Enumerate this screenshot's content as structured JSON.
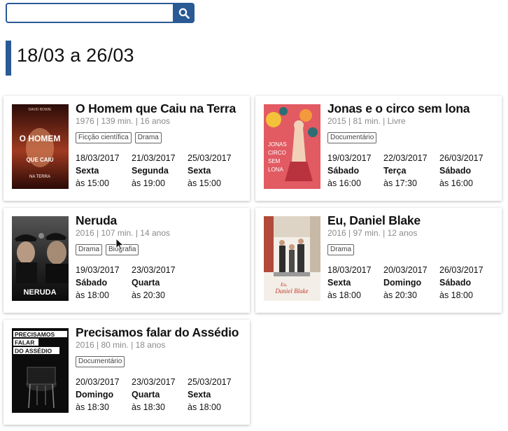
{
  "search": {
    "placeholder": "",
    "value": ""
  },
  "title": "18/03 a 26/03",
  "movies": [
    {
      "title": "O Homem que Caiu na Terra",
      "meta": "1976 | 139 min. | 16 anos",
      "tags": [
        "Ficção científica",
        "Drama"
      ],
      "poster_text": [
        "DAVID BOWIE",
        "O HOMEM",
        "QUE CAIU",
        "NA TERRA"
      ],
      "sessions": [
        {
          "date": "18/03/2017",
          "day": "Sexta",
          "time": "às 15:00"
        },
        {
          "date": "21/03/2017",
          "day": "Segunda",
          "time": "às 19:00"
        },
        {
          "date": "25/03/2017",
          "day": "Sexta",
          "time": "às 15:00"
        }
      ]
    },
    {
      "title": "Jonas e o circo sem lona",
      "meta": "2015 | 81 min. | Livre",
      "tags": [
        "Documentário"
      ],
      "poster_text": [
        "JONAS",
        "CIRCO",
        "SEM",
        "LONA"
      ],
      "sessions": [
        {
          "date": "19/03/2017",
          "day": "Sábado",
          "time": "às 16:00"
        },
        {
          "date": "22/03/2017",
          "day": "Terça",
          "time": "às 17:30"
        },
        {
          "date": "26/03/2017",
          "day": "Sábado",
          "time": "às 16:00"
        }
      ]
    },
    {
      "title": "Neruda",
      "meta": "2016 | 107 min. | 14 anos",
      "tags": [
        "Drama",
        "Biografia"
      ],
      "poster_text": [
        "NERUDA"
      ],
      "sessions": [
        {
          "date": "19/03/2017",
          "day": "Sábado",
          "time": "às 18:00"
        },
        {
          "date": "23/03/2017",
          "day": "Quarta",
          "time": "às 20:30"
        }
      ]
    },
    {
      "title": "Eu, Daniel Blake",
      "meta": "2016 | 97 min. | 12 anos",
      "tags": [
        "Drama"
      ],
      "poster_text": [
        "Eu,",
        "Daniel Blake"
      ],
      "sessions": [
        {
          "date": "18/03/2017",
          "day": "Sexta",
          "time": "às 18:00"
        },
        {
          "date": "20/03/2017",
          "day": "Domingo",
          "time": "às 20:30"
        },
        {
          "date": "26/03/2017",
          "day": "Sábado",
          "time": "às 18:00"
        }
      ]
    },
    {
      "title": "Precisamos falar do Assédio",
      "meta": "2016 | 80 min. | 18 anos",
      "tags": [
        "Documentário"
      ],
      "poster_text": [
        "PRECISAMOS",
        "FALAR",
        "DO ASSÉDIO"
      ],
      "sessions": [
        {
          "date": "20/03/2017",
          "day": "Domingo",
          "time": "às 18:30"
        },
        {
          "date": "23/03/2017",
          "day": "Quarta",
          "time": "às 18:30"
        },
        {
          "date": "25/03/2017",
          "day": "Sexta",
          "time": "às 18:00"
        }
      ]
    }
  ],
  "colors": {
    "accent": "#2a5a95"
  },
  "icons": {
    "search": "search-icon",
    "cursor": "mouse-pointer-icon"
  }
}
